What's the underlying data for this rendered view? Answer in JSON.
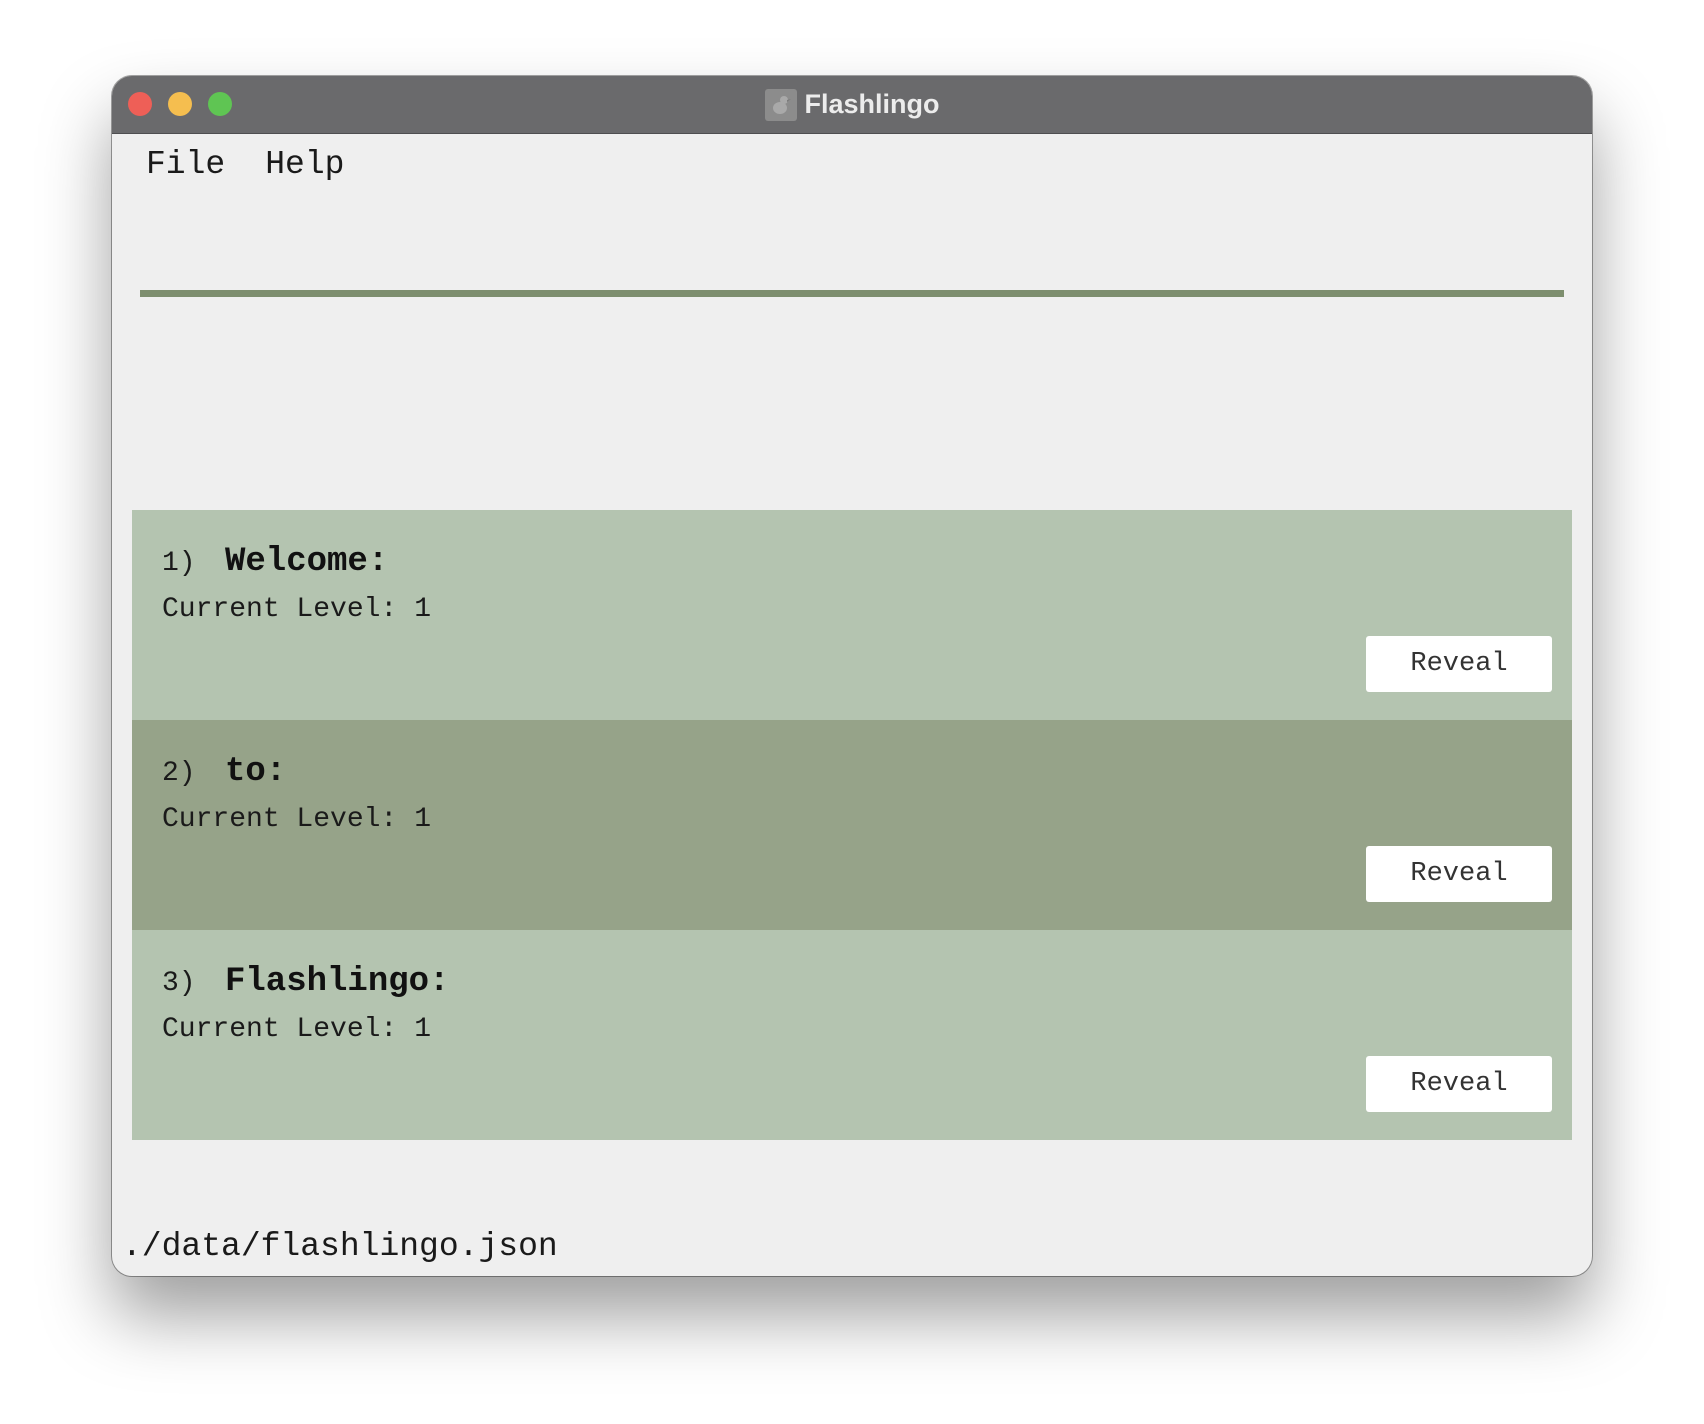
{
  "window": {
    "title": "Flashlingo",
    "app_icon": "flashlingo-app-icon"
  },
  "menu": {
    "items": [
      "File",
      "Help"
    ]
  },
  "colors": {
    "titlebar": "#6a6a6c",
    "separator": "#7d8e6e",
    "card_light": "#b4c4b0",
    "card_dark": "#96a389",
    "button": "#ffffff"
  },
  "cards": [
    {
      "index": "1)",
      "word": "Welcome:",
      "level_label": "Current Level:",
      "level_value": "1",
      "button_label": "Reveal"
    },
    {
      "index": "2)",
      "word": "to:",
      "level_label": "Current Level:",
      "level_value": "1",
      "button_label": "Reveal"
    },
    {
      "index": "3)",
      "word": "Flashlingo:",
      "level_label": "Current Level:",
      "level_value": "1",
      "button_label": "Reveal"
    }
  ],
  "status": {
    "file_path": "./data/flashlingo.json"
  }
}
